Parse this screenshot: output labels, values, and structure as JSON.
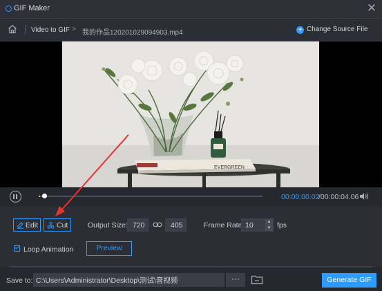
{
  "window": {
    "title": "GIF Maker",
    "close_icon": "close-icon"
  },
  "breadcrumb": {
    "home_icon": "home-icon",
    "section": "Video to GIF",
    "separator": ">",
    "file": "我的作品120201029094903.mp4"
  },
  "change_source": {
    "label": "Change Source File",
    "icon": "plus-circle-icon"
  },
  "player": {
    "current_time": "00:00:00.02",
    "total_time": "/00:00:04.06",
    "progress": 0.005,
    "book_title": "EVERGREEN"
  },
  "settings": {
    "edit_label": "Edit",
    "cut_label": "Cut",
    "output_size_label": "Output Size:",
    "width": "720",
    "height": "405",
    "frame_rate_label": "Frame Rate:",
    "frame_rate": "10",
    "fps_label": "fps",
    "loop_label": "Loop Animation",
    "loop_checked": true,
    "preview_label": "Preview"
  },
  "footer": {
    "save_to_label": "Save to:",
    "save_path": "C:\\Users\\Administrator\\Desktop\\测试\\音视频",
    "browse_label": "···",
    "generate_label": "Generate GIF"
  },
  "colors": {
    "accent": "#2e9bff",
    "progress": "#f6b12b",
    "annotation": "#e8322d"
  }
}
